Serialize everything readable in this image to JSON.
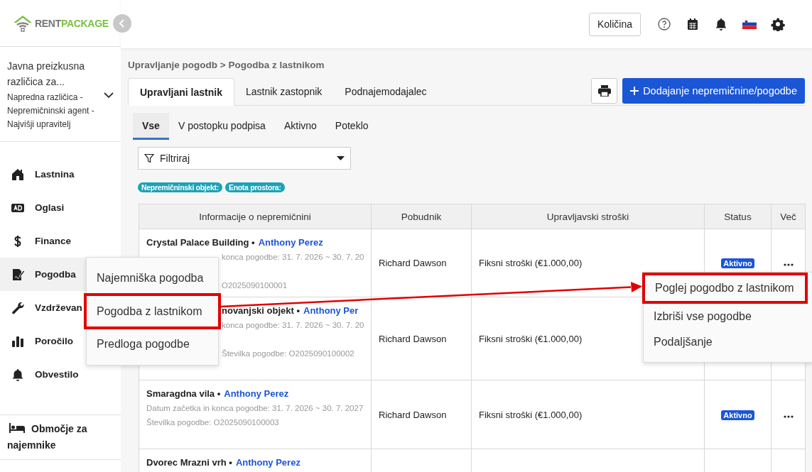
{
  "logo": {
    "part_1": "RENT",
    "part_2": "PACKAGE"
  },
  "header": {
    "quantity_button": "Količina"
  },
  "account": {
    "name": "Javna preizkusna različica za...",
    "plan": "Napredna različica - Nepremičninski agent - Najvišji upravitelj"
  },
  "sidebar": {
    "items": [
      {
        "label": "Lastnina",
        "selected": false
      },
      {
        "label": "Oglasi",
        "selected": false
      },
      {
        "label": "Finance",
        "selected": false
      },
      {
        "label": "Pogodba",
        "selected": true
      },
      {
        "label": "Vzdrževan",
        "selected": false
      },
      {
        "label": "Poročilo",
        "selected": false
      },
      {
        "label": "Obvestilo",
        "selected": false
      }
    ],
    "footer": "Območje za najemnike"
  },
  "breadcrumb": "Upravljanje pogodb > Pogodba z lastnikom",
  "tabs": [
    {
      "label": "Upravljani lastnik",
      "selected": true
    },
    {
      "label": "Lastnik zastopnik",
      "selected": false
    },
    {
      "label": "Podnajemodajalec",
      "selected": false
    }
  ],
  "add_button": "Dodajanje nepremičnine/pogodbe",
  "subtabs": [
    {
      "label": "Vse",
      "selected": true
    },
    {
      "label": "V postopku podpisa",
      "selected": false
    },
    {
      "label": "Aktivno",
      "selected": false
    },
    {
      "label": "Poteklo",
      "selected": false
    }
  ],
  "filter": {
    "placeholder": "Filtriraj"
  },
  "tags": [
    "Nepremičninski objekt:",
    "Enota prostora:"
  ],
  "table": {
    "columns": [
      "Informacije o nepremičnini",
      "Pobudnik",
      "Upravljavski stroški",
      "Status",
      "Več"
    ],
    "rows": [
      {
        "title": "Crystal Palace Building •",
        "owner": "Anthony Perez",
        "dates": "konca pogodbe: 31. 7. 2026 ~ 30. 7. 20",
        "number": "O2025090100001",
        "initiator": "Richard Dawson",
        "fees": "Fiksni stroški (€1.000,00)",
        "status": "Aktivno"
      },
      {
        "title": "novanjski objekt •",
        "owner": "Anthony Per",
        "dates": "konca pogodbe: 31. 7. 2026 ~ 30. 7. 20",
        "number": "Številka pogodbe: O2025090100002",
        "initiator": "Richard Dawson",
        "fees": "Fiksni stroški (€1.000,00)"
      },
      {
        "title": "Smaragdna vila •",
        "owner": "Anthony Perez",
        "dates": "Datum začetka in konca pogodbe: 31. 7. 2026 ~ 30. 7. 2027",
        "number": "Številka pogodbe: O2025090100003",
        "initiator": "Richard Dawson",
        "fees": "Fiksni stroški (€1.000,00)",
        "status": "Aktivno"
      },
      {
        "title": "Dvorec Mrazni vrh •",
        "owner": "Anthony Perez"
      }
    ]
  },
  "contract_menu": {
    "items": [
      {
        "label": "Najemniška pogodba",
        "highlighted": false
      },
      {
        "label": "Pogodba z lastnikom",
        "highlighted": true
      },
      {
        "label": "Predloga pogodbe",
        "highlighted": false
      }
    ]
  },
  "row_menu": {
    "items": [
      {
        "label": "Poglej pogodbo z lastnikom",
        "highlighted": true
      },
      {
        "label": "Izbriši vse pogodbe",
        "highlighted": false
      },
      {
        "label": "Podaljšanje",
        "highlighted": false
      }
    ]
  }
}
